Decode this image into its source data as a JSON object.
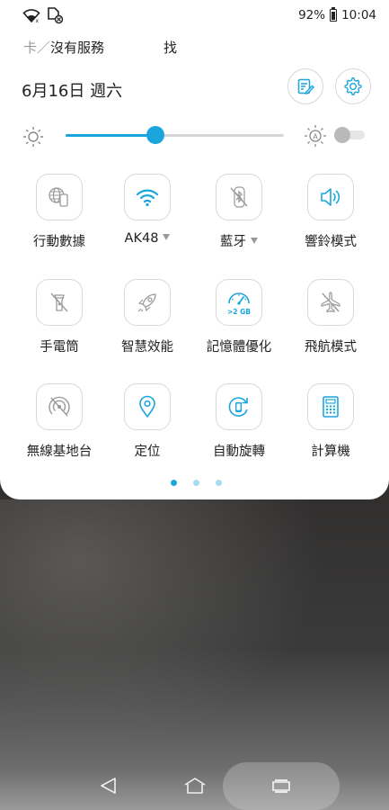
{
  "status_bar": {
    "battery": "92%",
    "time": "10:04"
  },
  "carrier": {
    "left_fade": "卡／",
    "left_text": "沒有服務",
    "right_text": "找"
  },
  "date": "6月16日 週六",
  "brightness": {
    "level": 0.41,
    "auto": false
  },
  "tiles": [
    {
      "id": "mobile-data",
      "label": "行動數據",
      "icon": "globe-phone-icon",
      "active": false,
      "caret": false
    },
    {
      "id": "wifi",
      "label": "AK48",
      "icon": "wifi-icon",
      "active": true,
      "caret": true
    },
    {
      "id": "bluetooth",
      "label": "藍牙",
      "icon": "bluetooth-off-icon",
      "active": false,
      "caret": true
    },
    {
      "id": "ring-mode",
      "label": "響鈴模式",
      "icon": "speaker-icon",
      "active": true,
      "caret": false
    },
    {
      "id": "flashlight",
      "label": "手電筒",
      "icon": "flashlight-off-icon",
      "active": false,
      "caret": false
    },
    {
      "id": "smart-performance",
      "label": "智慧效能",
      "icon": "rocket-icon",
      "active": false,
      "caret": false
    },
    {
      "id": "memory-boost",
      "label": "記憶體優化",
      "icon": "speedometer-icon",
      "badge": ">2 GB",
      "active": true,
      "caret": false
    },
    {
      "id": "airplane-mode",
      "label": "飛航模式",
      "icon": "airplane-off-icon",
      "active": false,
      "caret": false
    },
    {
      "id": "hotspot",
      "label": "無線基地台",
      "icon": "hotspot-off-icon",
      "active": false,
      "caret": false
    },
    {
      "id": "location",
      "label": "定位",
      "icon": "location-pin-icon",
      "active": true,
      "caret": false
    },
    {
      "id": "auto-rotate",
      "label": "自動旋轉",
      "icon": "auto-rotate-icon",
      "active": true,
      "caret": false
    },
    {
      "id": "calculator",
      "label": "計算機",
      "icon": "calculator-icon",
      "active": true,
      "caret": false
    }
  ],
  "page_indicator": {
    "count": 3,
    "current": 0
  },
  "colors": {
    "accent": "#1aa6dd",
    "inactive_icon": "#9a9a9a",
    "text": "#222222",
    "dot_inactive": "#a6dcef"
  }
}
